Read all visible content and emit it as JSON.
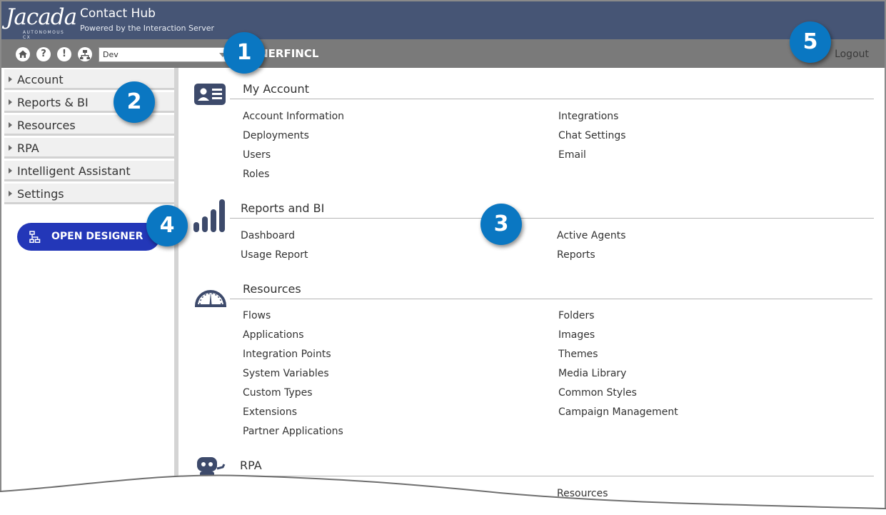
{
  "header": {
    "logo_text": "Jacada",
    "logo_tagline": "AUTONOMOUS CX",
    "app_title": "Contact Hub",
    "app_subtitle": "Powered by the Interaction Server"
  },
  "toolbar": {
    "icons": [
      "home-icon",
      "help-icon",
      "alert-icon",
      "network-icon"
    ],
    "env_select_value": "Dev",
    "account_name": "RTNERFINCL",
    "logout_label": "Logout"
  },
  "sidebar": {
    "items": [
      {
        "label": "Account"
      },
      {
        "label": "Reports & BI"
      },
      {
        "label": "Resources"
      },
      {
        "label": "RPA"
      },
      {
        "label": "Intelligent Assistant"
      },
      {
        "label": "Settings"
      }
    ],
    "designer_button": "OPEN DESIGNER"
  },
  "sections": {
    "account": {
      "title": "My Account",
      "left": [
        "Account Information",
        "Deployments",
        "Users",
        "Roles"
      ],
      "right": [
        "Integrations",
        "Chat Settings",
        "Email"
      ]
    },
    "reports": {
      "title": "Reports and BI",
      "left": [
        "Dashboard",
        "Usage Report"
      ],
      "right": [
        "Active Agents",
        "Reports"
      ]
    },
    "resources": {
      "title": "Resources",
      "left": [
        "Flows",
        "Applications",
        "Integration Points",
        "System Variables",
        "Custom Types",
        "Extensions",
        "Partner Applications"
      ],
      "right": [
        "Folders",
        "Images",
        "Themes",
        "Media Library",
        "Common Styles",
        "Campaign Management"
      ]
    },
    "rpa": {
      "title": "RPA",
      "right": [
        "Resources"
      ]
    }
  },
  "callouts": [
    "1",
    "2",
    "3",
    "4",
    "5"
  ],
  "colors": {
    "header_bg": "#465575",
    "toolbar_bg": "#7a7a7a",
    "designer_button": "#2337b8",
    "callout": "#0a77c2",
    "icon_navy": "#3d4a6b"
  }
}
